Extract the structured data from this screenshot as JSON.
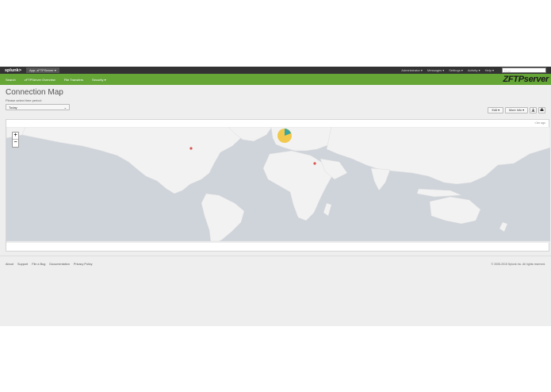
{
  "topbar": {
    "logo": "splunk>",
    "app_switch": "App: zFTPServer ▾",
    "menus": [
      "Administrator ▾",
      "Messages ▾",
      "Settings ▾",
      "Activity ▾",
      "Help ▾"
    ],
    "find_placeholder": "Find"
  },
  "nav": {
    "items": [
      "Search",
      "zFTPServer Overview",
      "File Transfers",
      "Security ▾"
    ],
    "brand": "FTPserver",
    "brand_prefix": "Z"
  },
  "header": {
    "title": "Connection Map",
    "period_label": "Please select time period:",
    "period_value": "Today",
    "edit_label": "Edit ▾",
    "more_info_label": "More Info ▾"
  },
  "panel": {
    "refresh_text": "<1m ago",
    "zoom_in": "+",
    "zoom_out": "−",
    "markers": [
      {
        "name": "north-america-marker",
        "color": "#d9534f"
      },
      {
        "name": "middle-east-marker",
        "color": "#d9534f"
      },
      {
        "name": "europe-pie-marker",
        "colors": [
          "#f2c94c",
          "#3ba6a0"
        ]
      }
    ]
  },
  "footer": {
    "links": [
      "About",
      "Support",
      "File a Bug",
      "Documentation",
      "Privacy Policy"
    ],
    "copyright": "© 2005-2015 Splunk Inc. All rights reserved."
  },
  "colors": {
    "nav_green": "#65a637",
    "topbar_dark": "#333333",
    "water": "#cfd4db",
    "land": "#f2f2f2"
  }
}
